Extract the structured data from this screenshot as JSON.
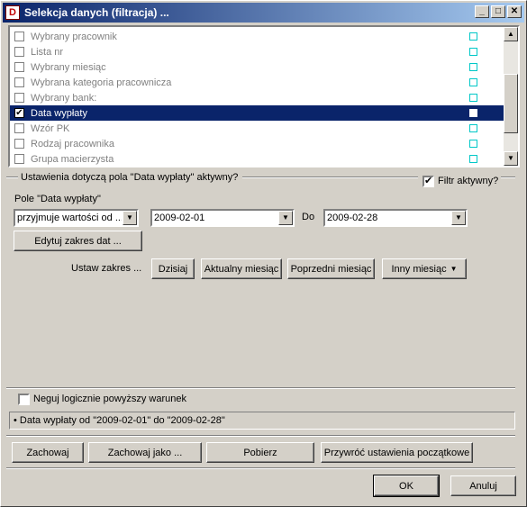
{
  "window": {
    "title": "Selekcja danych (filtracja) ...",
    "min": "_",
    "max": "□",
    "close": "✕",
    "icon": "D"
  },
  "fields": [
    {
      "label": "Wybrany pracownik",
      "checked": false
    },
    {
      "label": "Lista nr",
      "checked": false
    },
    {
      "label": "Wybrany miesiąc",
      "checked": false
    },
    {
      "label": "Wybrana kategoria pracownicza",
      "checked": false
    },
    {
      "label": "Wybrany bank:",
      "checked": false
    },
    {
      "label": "Data wypłaty",
      "checked": true
    },
    {
      "label": "Wzór PK",
      "checked": false
    },
    {
      "label": "Rodzaj pracownika",
      "checked": false
    },
    {
      "label": "Grupa macierzysta",
      "checked": false
    }
  ],
  "check_mark": "✔",
  "scroll": {
    "up": "▲",
    "down": "▼"
  },
  "settings": {
    "heading": "Ustawienia dotyczą pola \"Data wypłaty\" aktywny?",
    "filter_active_label": "Filtr aktywny?",
    "field_label": "Pole \"Data wypłaty\"",
    "condition_value": "przyjmuje wartości od ...",
    "date_from": "2009-02-01",
    "do_label": "Do",
    "date_to": "2009-02-28",
    "edit_range_button": "Edytuj zakres dat ...",
    "set_range_label": "Ustaw zakres ...",
    "today_button": "Dzisiaj",
    "current_month_button": "Aktualny miesiąc",
    "previous_month_button": "Poprzedni miesiąc",
    "other_month_button": "Inny miesiąc",
    "dropdown_arrow": "▼"
  },
  "negate_label": "Neguj logicznie powyższy warunek",
  "summary": "• Data wypłaty od \"2009-02-01\" do \"2009-02-28\"",
  "actions": {
    "save": "Zachowaj",
    "save_as": "Zachowaj jako ...",
    "load": "Pobierz",
    "reset": "Przywróć ustawienia początkowe"
  },
  "dialog": {
    "ok": "OK",
    "cancel": "Anuluj"
  }
}
